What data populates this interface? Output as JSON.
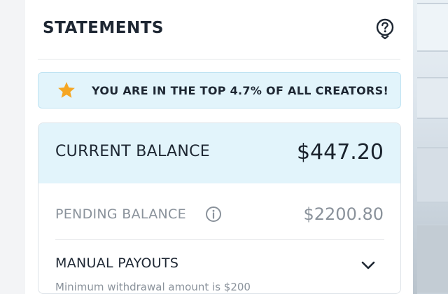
{
  "header": {
    "title": "STATEMENTS",
    "help_icon": "question-circle-icon"
  },
  "banner": {
    "icon": "star-icon",
    "icon_color": "#f5a623",
    "text": "YOU ARE IN THE TOP 4.7% OF ALL CREATORS!"
  },
  "balances": {
    "current_label": "CURRENT BALANCE",
    "current_value": "$447.20",
    "pending_label": "PENDING BALANCE",
    "pending_info_icon": "info-icon",
    "pending_value": "$2200.80"
  },
  "payouts": {
    "label": "MANUAL PAYOUTS",
    "chevron_icon": "chevron-down-icon",
    "hint": "Minimum withdrawal amount is $200"
  },
  "colors": {
    "highlight_bg": "#e2f4fb",
    "text_primary": "#1e2733",
    "text_muted": "#8a929b"
  }
}
